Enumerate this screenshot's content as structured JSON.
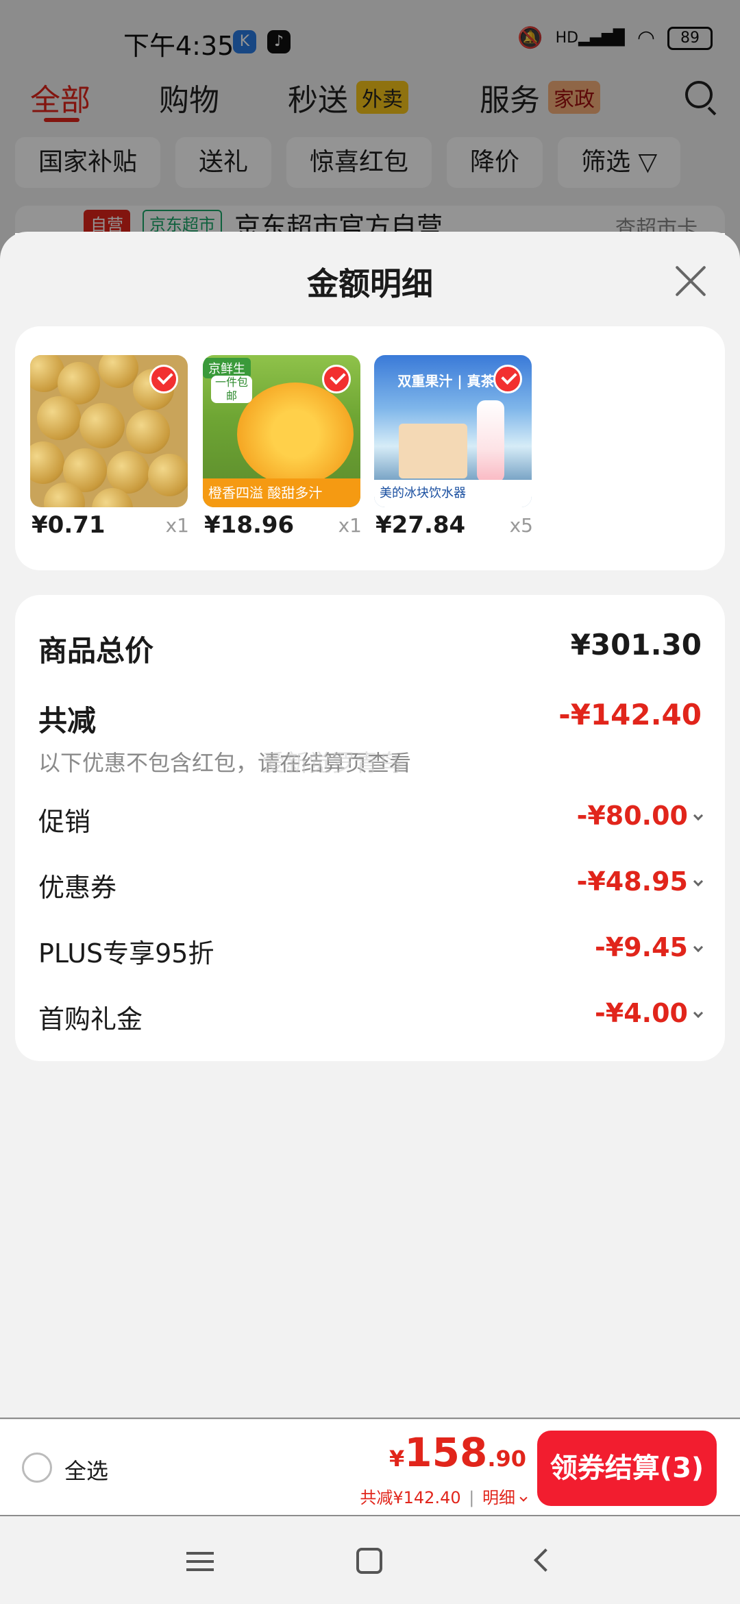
{
  "status_bar": {
    "time": "下午4:35",
    "hd": "HD",
    "battery": "89"
  },
  "top_nav": {
    "tabs": [
      {
        "label": "全部",
        "active": true
      },
      {
        "label": "购物"
      },
      {
        "label": "秒送",
        "badge": "外卖"
      },
      {
        "label": "服务",
        "badge": "家政"
      }
    ]
  },
  "filter_chips": [
    "国家补贴",
    "送礼",
    "惊喜红包",
    "降价",
    "筛选"
  ],
  "store": {
    "tag_self": "自营",
    "tag_super": "京东超市",
    "name": "京东超市官方自营",
    "action": "查超市卡"
  },
  "sheet": {
    "title": "金额明细",
    "products": [
      {
        "price": "¥0.71",
        "qty": "x1"
      },
      {
        "price": "¥18.96",
        "qty": "x1",
        "img_tag": "京鲜生",
        "img_leaf": "一件包邮",
        "img_banner": "橙香四溢 酸甜多汁"
      },
      {
        "price": "¥27.84",
        "qty": "x5",
        "img_top": "双重果汁 | 真茶汤",
        "img_banner": "美的冰块饮水器"
      }
    ],
    "summary": {
      "total_label": "商品总价",
      "total_value": "¥301.30",
      "discount_label": "共减",
      "discount_value": "-¥142.40",
      "note": "以下优惠不包含红包，请在结算页查看",
      "watermark": "爱新觉罗青鸟",
      "items": [
        {
          "label": "促销",
          "value": "-¥80.00"
        },
        {
          "label": "优惠券",
          "value": "-¥48.95"
        },
        {
          "label": "PLUS专享95折",
          "value": "-¥9.45"
        },
        {
          "label": "首购礼金",
          "value": "-¥4.00"
        }
      ]
    }
  },
  "bottom_bar": {
    "select_all": "全选",
    "total_symbol": "¥",
    "total_int": "158",
    "total_dec": ".90",
    "saved": "共减¥142.40",
    "separator": "|",
    "detail": "明细",
    "checkout": "领券结算(3)"
  },
  "colors": {
    "accent": "#e1251b",
    "button": "#f21d2f"
  }
}
